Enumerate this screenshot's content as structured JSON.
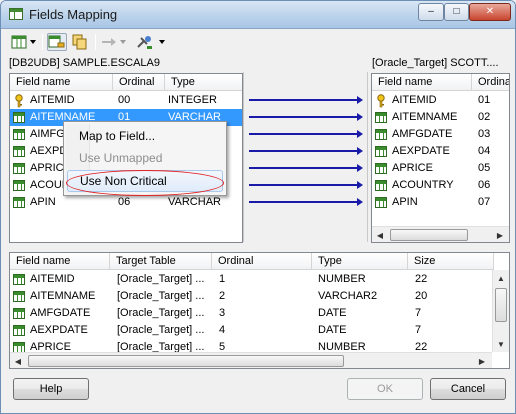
{
  "window": {
    "title": "Fields Mapping"
  },
  "titlebar_buttons": {
    "minimize": "–",
    "maximize": "□",
    "close": "✕"
  },
  "source": {
    "label": "[DB2UDB] SAMPLE.ESCALA9",
    "columns": [
      "Field name",
      "Ordinal",
      "Type"
    ],
    "rows": [
      {
        "name": "AITEMID",
        "ordinal": "00",
        "type": "INTEGER",
        "icon": "key-icon"
      },
      {
        "name": "AITEMNAME",
        "ordinal": "01",
        "type": "VARCHAR",
        "icon": "grid-icon",
        "selected": true
      },
      {
        "name": "AIMFGDATE",
        "ordinal": "",
        "type": "",
        "icon": "grid-icon"
      },
      {
        "name": "AEXPDATE",
        "ordinal": "",
        "type": "",
        "icon": "grid-icon"
      },
      {
        "name": "APRICE",
        "ordinal": "",
        "type": "",
        "icon": "grid-icon"
      },
      {
        "name": "ACOUNTRY",
        "ordinal": "",
        "type": "",
        "icon": "grid-icon"
      },
      {
        "name": "APIN",
        "ordinal": "06",
        "type": "VARCHAR",
        "icon": "grid-icon"
      }
    ]
  },
  "target": {
    "label": "[Oracle_Target] SCOTT....",
    "columns": [
      "Field name",
      "Ordina"
    ],
    "rows": [
      {
        "name": "AITEMID",
        "ordinal": "01",
        "icon": "key-icon"
      },
      {
        "name": "AITEMNAME",
        "ordinal": "02",
        "icon": "grid-icon"
      },
      {
        "name": "AMFGDATE",
        "ordinal": "03",
        "icon": "grid-icon"
      },
      {
        "name": "AEXPDATE",
        "ordinal": "04",
        "icon": "grid-icon"
      },
      {
        "name": "APRICE",
        "ordinal": "05",
        "icon": "grid-icon"
      },
      {
        "name": "ACOUNTRY",
        "ordinal": "06",
        "icon": "grid-icon"
      },
      {
        "name": "APIN",
        "ordinal": "07",
        "icon": "grid-icon"
      }
    ]
  },
  "context_menu": {
    "items": [
      {
        "label": "Map to Field...",
        "disabled": false
      },
      {
        "label": "Use Unmapped",
        "disabled": true
      },
      {
        "label": "Use Non Critical",
        "disabled": false,
        "hover": true
      }
    ]
  },
  "mapping": {
    "columns": [
      "Field name",
      "Target Table",
      "Ordinal",
      "Type",
      "Size"
    ],
    "rows": [
      {
        "name": "AITEMID",
        "table": "[Oracle_Target] ...",
        "ordinal": "1",
        "type": "NUMBER",
        "size": "22"
      },
      {
        "name": "AITEMNAME",
        "table": "[Oracle_Target] ...",
        "ordinal": "2",
        "type": "VARCHAR2",
        "size": "20"
      },
      {
        "name": "AMFGDATE",
        "table": "[Oracle_Target] ...",
        "ordinal": "3",
        "type": "DATE",
        "size": "7"
      },
      {
        "name": "AEXPDATE",
        "table": "[Oracle_Target] ...",
        "ordinal": "4",
        "type": "DATE",
        "size": "7"
      },
      {
        "name": "APRICE",
        "table": "[Oracle_Target] ...",
        "ordinal": "5",
        "type": "NUMBER",
        "size": "22"
      }
    ]
  },
  "buttons": {
    "help": "Help",
    "ok": "OK",
    "cancel": "Cancel"
  },
  "colors": {
    "selection": "#3399ff",
    "arrow": "#1a1aa8",
    "highlight_oval": "#e02020"
  }
}
